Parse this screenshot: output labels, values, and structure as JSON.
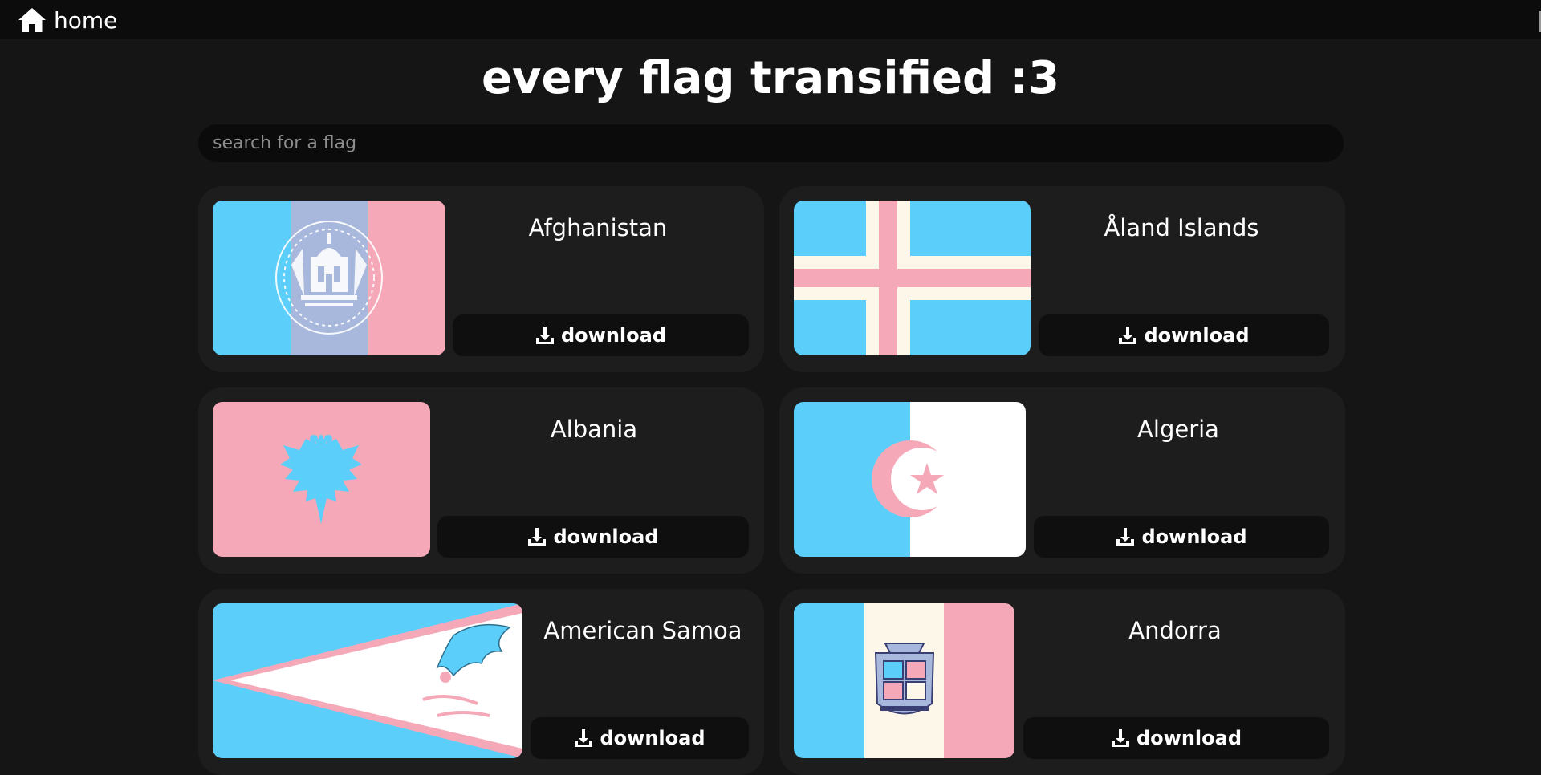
{
  "nav": {
    "home_label": "home"
  },
  "page": {
    "title": "every flag transified :3"
  },
  "search": {
    "placeholder": "search for a flag"
  },
  "flags": [
    {
      "name": "Afghanistan",
      "download_label": "download"
    },
    {
      "name": "Åland Islands",
      "download_label": "download"
    },
    {
      "name": "Albania",
      "download_label": "download"
    },
    {
      "name": "Algeria",
      "download_label": "download"
    },
    {
      "name": "American Samoa",
      "download_label": "download"
    },
    {
      "name": "Andorra",
      "download_label": "download"
    }
  ],
  "colors": {
    "background": "#151515",
    "topbar": "#0c0c0c",
    "card": "#1d1d1d",
    "button": "#0f0f0f",
    "trans_blue": "#5bcefa",
    "trans_pink": "#f5a9b8",
    "trans_white": "#ffffff",
    "cream": "#fdf7ea",
    "lavender": "#a8b8dc"
  },
  "icons": {
    "home": "house-icon",
    "download": "download-icon"
  }
}
